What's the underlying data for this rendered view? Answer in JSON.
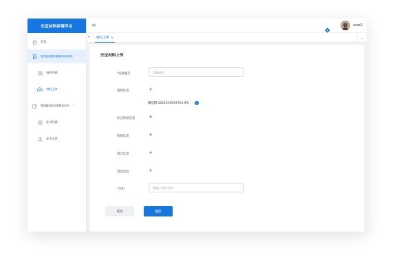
{
  "app": {
    "brand": "交证材料存储平台"
  },
  "header": {
    "username": "user2"
  },
  "sidebar": {
    "items": [
      {
        "label": "首页"
      },
      {
        "label": "因式制证器所属保养交证材料"
      },
      {
        "label": "材料列表"
      },
      {
        "label": "材料上传"
      },
      {
        "label": "隔漆器组轮证器锁证证书"
      },
      {
        "label": "证书列表"
      },
      {
        "label": "证书上传"
      }
    ]
  },
  "tabs": [
    {
      "label": "材料上传"
    }
  ],
  "form": {
    "title": "交证材料上传",
    "fields": {
      "device_no": {
        "label": "*设备编号",
        "placeholder": "设备编号",
        "value": ""
      },
      "nameplate": {
        "label": "铭牌信息"
      },
      "workplace": {
        "label": "作业场地信息"
      },
      "disassembly": {
        "label": "拆解信息"
      },
      "cleaning": {
        "label": "清洁信息"
      },
      "brake_test": {
        "label": "制动试验"
      },
      "phone": {
        "label": "*手机",
        "placeholder": "请输入手机号码",
        "value": ""
      }
    },
    "uploaded_file": "微信图-2021019093724.JPG",
    "plus_symbol": "+",
    "cancel_label": "取消",
    "confirm_label": "确定"
  },
  "colors": {
    "primary": "#1677e0",
    "sidebar_active_bg": "#e6f0fc",
    "page_bg": "#f0f2f5"
  }
}
